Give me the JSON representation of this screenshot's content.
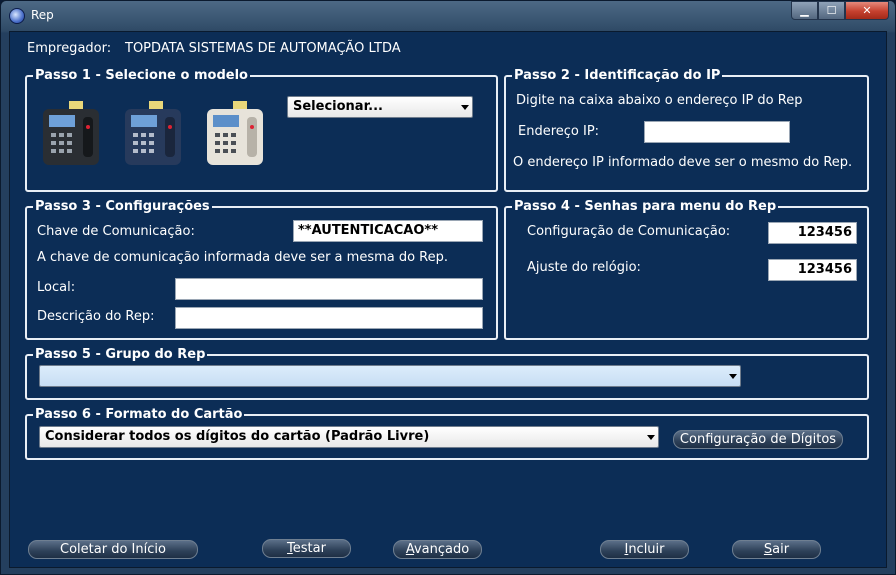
{
  "window": {
    "title": "Rep",
    "buttons": {
      "minimize": "▁",
      "maximize": "☐",
      "close": "✕"
    }
  },
  "empregador": {
    "label": "Empregador:",
    "value": "TOPDATA SISTEMAS DE AUTOMAÇÃO LTDA"
  },
  "passo1": {
    "legend": "Passo 1 - Selecione o modelo",
    "select_value": "Selecionar...",
    "devices": [
      "dark-device",
      "blue-device",
      "white-device"
    ]
  },
  "passo2": {
    "legend": "Passo 2 - Identificação do IP",
    "instruction": "Digite na caixa abaixo o endereço IP do Rep",
    "ip_label": "Endereço IP:",
    "ip_value": "",
    "note": "O endereço IP informado deve ser o mesmo do Rep."
  },
  "passo3": {
    "legend": "Passo 3 - Configurações",
    "chave_label": "Chave de Comunicação:",
    "chave_value": "**AUTENTICACAO**",
    "note": "A chave de comunicação informada deve ser a mesma do Rep.",
    "local_label": "Local:",
    "local_value": "",
    "descricao_label": "Descrição do Rep:",
    "descricao_value": ""
  },
  "passo4": {
    "legend": "Passo 4 - Senhas para menu do Rep",
    "config_label": "Configuração de Comunicação:",
    "config_value": "123456",
    "ajuste_label": "Ajuste do relógio:",
    "ajuste_value": "123456"
  },
  "passo5": {
    "legend": "Passo 5 - Grupo do Rep",
    "select_value": ""
  },
  "passo6": {
    "legend": "Passo 6 - Formato do Cartão",
    "select_value": "Considerar todos os dígitos do cartão (Padrão Livre)",
    "config_button": "Configuração de Dígitos"
  },
  "footer": {
    "coletar": "Coletar do Início",
    "testar_pre": "",
    "testar_u": "T",
    "testar_post": "estar",
    "avancado_pre": "",
    "avancado_u": "A",
    "avancado_post": "vançado",
    "incluir_pre": "",
    "incluir_u": "I",
    "incluir_post": "ncluir",
    "sair_pre": "",
    "sair_u": "S",
    "sair_post": "air"
  }
}
